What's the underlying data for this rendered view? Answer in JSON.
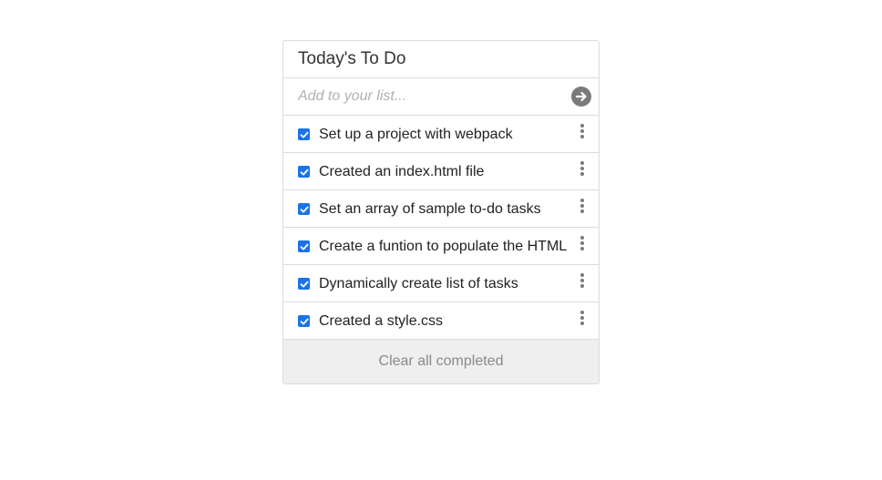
{
  "header": {
    "title": "Today's To Do"
  },
  "add": {
    "placeholder": "Add to your list...",
    "submit_icon": "arrow-right-circle-icon"
  },
  "tasks": [
    {
      "text": "Set up a project with webpack",
      "completed": true
    },
    {
      "text": "Created an index.html file",
      "completed": true
    },
    {
      "text": "Set an array of sample to-do tasks",
      "completed": true
    },
    {
      "text": "Create a funtion to populate the HTML",
      "completed": true
    },
    {
      "text": "Dynamically create list of tasks",
      "completed": true
    },
    {
      "text": "Created a style.css",
      "completed": true
    }
  ],
  "footer": {
    "clear_label": "Clear all completed"
  },
  "colors": {
    "checkbox": "#1a73e8",
    "icon": "#7a7a7a",
    "footer_bg": "#efefef"
  }
}
